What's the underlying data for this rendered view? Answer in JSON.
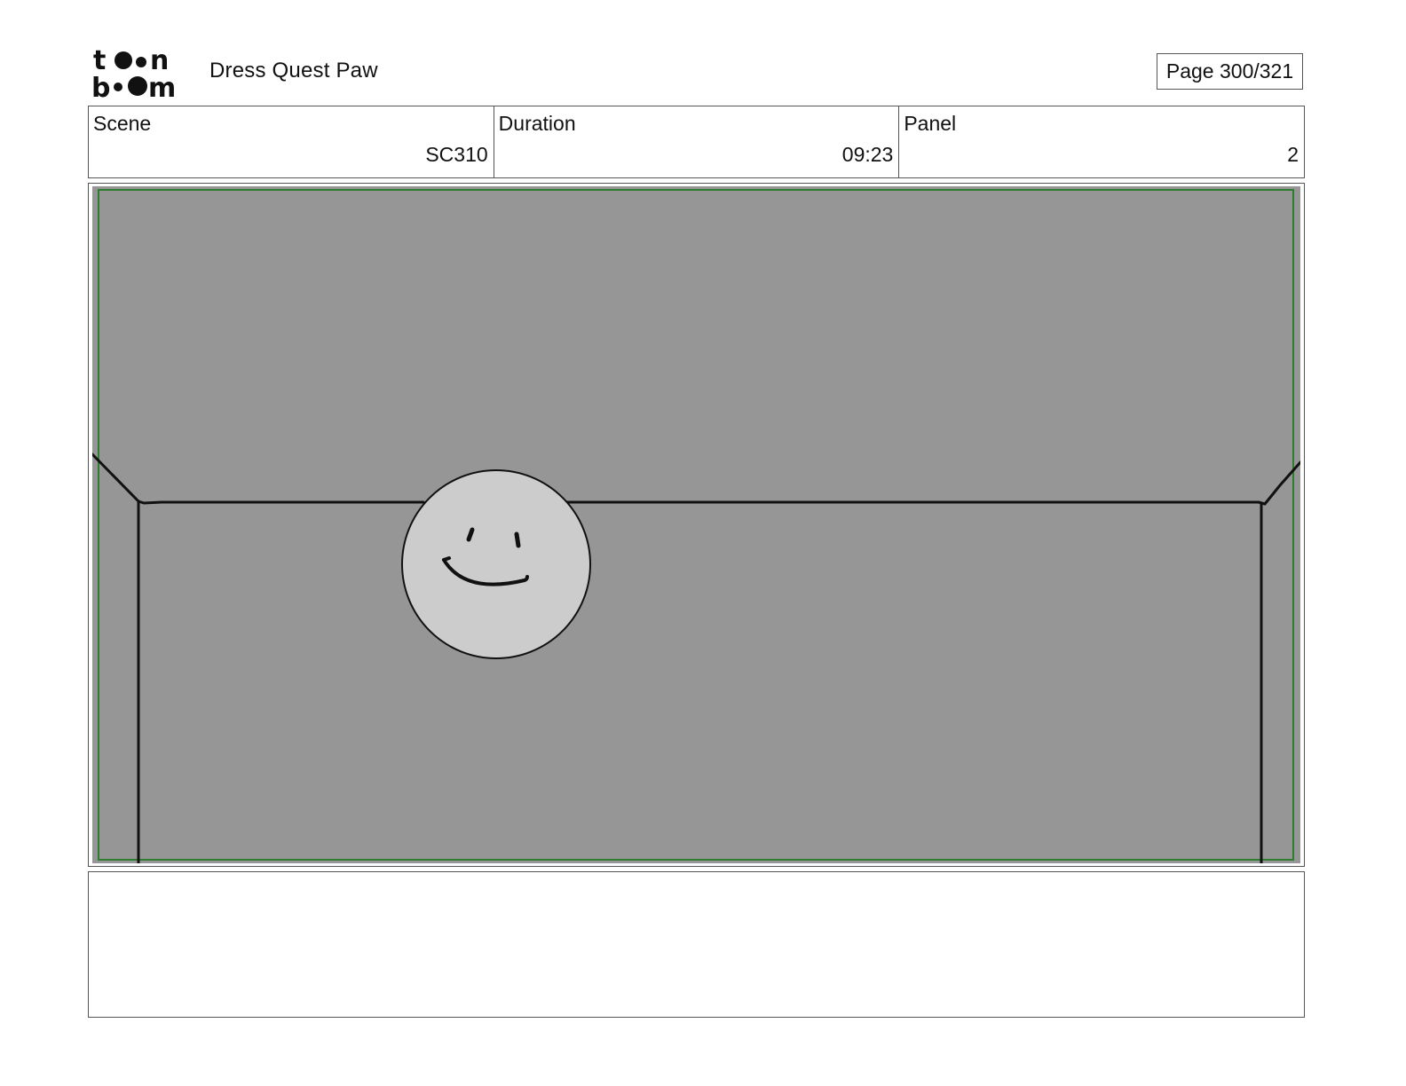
{
  "header": {
    "logo_text": "toon boom",
    "project_title": "Dress Quest Paw",
    "page_indicator": "Page 300/321"
  },
  "info": {
    "scene": {
      "label": "Scene",
      "value": "SC310"
    },
    "duration": {
      "label": "Duration",
      "value": "09:23"
    },
    "panel": {
      "label": "Panel",
      "value": "2"
    }
  },
  "panel_image": {
    "description_icon": "smiley-face-icon",
    "background_color": "#969696",
    "safe_area_color": "#2e7d2e",
    "face_color": "#cccccc"
  },
  "notes": {
    "text": ""
  }
}
